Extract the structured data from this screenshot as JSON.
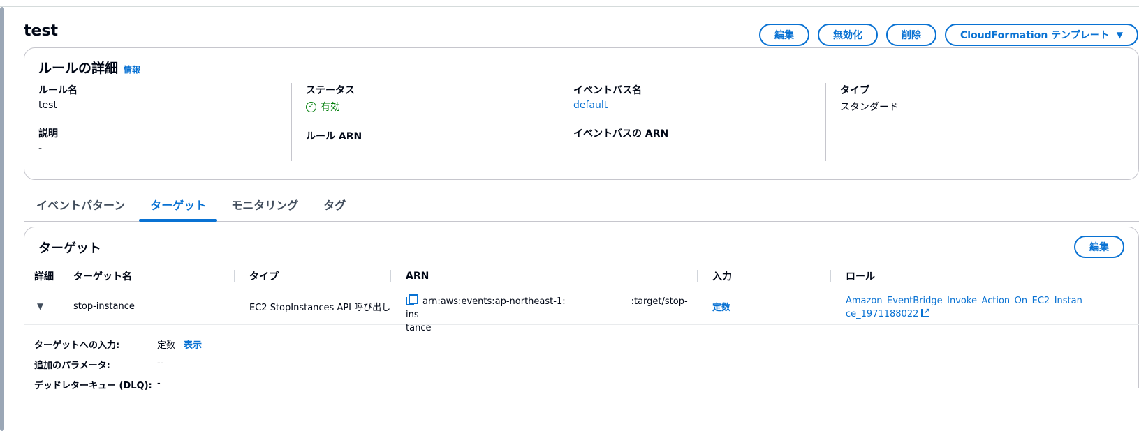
{
  "page": {
    "title": "test",
    "actions": {
      "edit": "編集",
      "disable": "無効化",
      "delete": "削除",
      "cloudformation": "CloudFormation テンプレート"
    }
  },
  "details": {
    "title": "ルールの詳細",
    "info": "情報",
    "rule_name_label": "ルール名",
    "rule_name": "test",
    "description_label": "説明",
    "description": "-",
    "status_label": "ステータス",
    "status": "有効",
    "rule_arn_label": "ルール ARN",
    "event_bus_label": "イベントバス名",
    "event_bus": "default",
    "event_bus_arn_label": "イベントバスの ARN",
    "type_label": "タイプ",
    "type": "スタンダード"
  },
  "tabs": [
    {
      "label": "イベントパターン",
      "active": false
    },
    {
      "label": "ターゲット",
      "active": true
    },
    {
      "label": "モニタリング",
      "active": false
    },
    {
      "label": "タグ",
      "active": false
    }
  ],
  "targets": {
    "title": "ターゲット",
    "edit": "編集",
    "columns": {
      "detail": "詳細",
      "name": "ターゲット名",
      "type": "タイプ",
      "arn": "ARN",
      "input": "入力",
      "role": "ロール"
    },
    "row": {
      "name": "stop-instance",
      "type": "EC2 StopInstances API 呼び出し",
      "arn_part1": "arn:aws:events:ap-northeast-1:",
      "arn_part2": ":target/stop-ins",
      "arn_part3": "tance",
      "input": "定数",
      "role": "Amazon_EventBridge_Invoke_Action_On_EC2_Instance_1971188022"
    },
    "expanded": {
      "input_label": "ターゲットへの入力:",
      "input_value": "定数",
      "input_show": "表示",
      "params_label": "追加のパラメータ:",
      "params_value": "--",
      "dlq_label": "デッドレターキュー (DLQ):",
      "dlq_value": "-"
    }
  }
}
